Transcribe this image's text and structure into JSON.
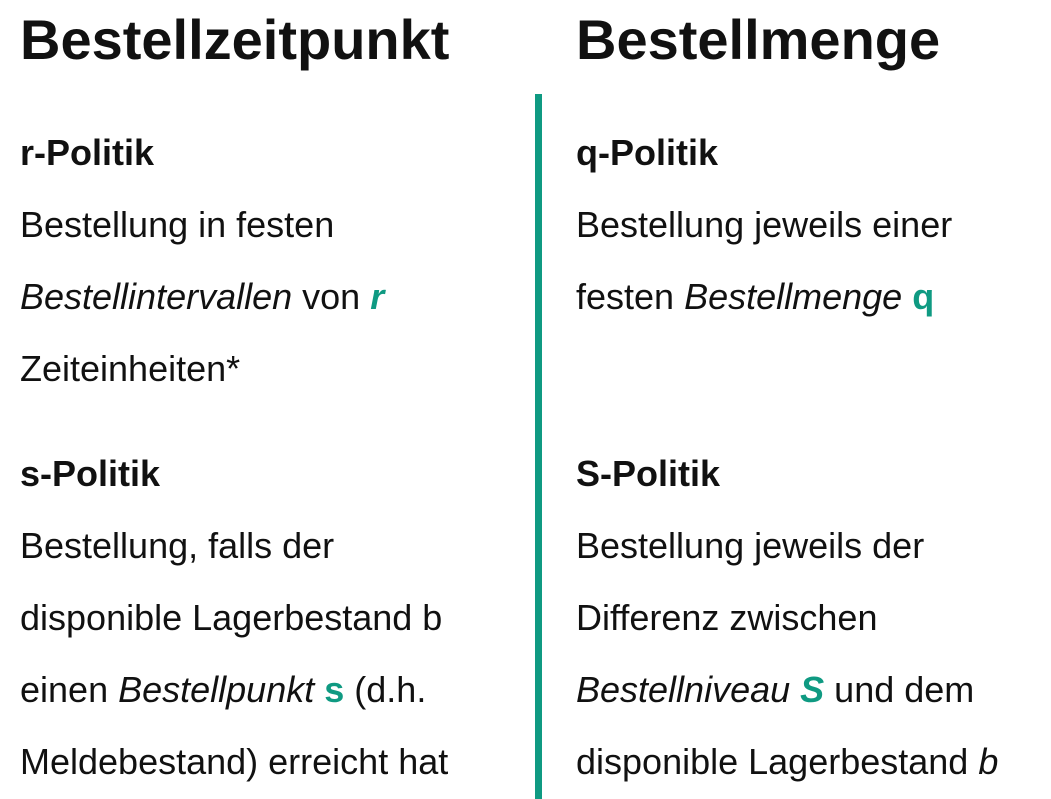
{
  "headings": {
    "left": "Bestellzeitpunkt",
    "right": "Bestellmenge"
  },
  "accent_color": "#0f9a82",
  "r_politik": {
    "title": "r-Politik",
    "line1": "Bestellung in festen",
    "line2_italic": "Bestellintervallen",
    "line2_text": " von ",
    "line2_var": "r",
    "line3": "Zeiteinheiten*"
  },
  "q_politik": {
    "title": "q-Politik",
    "line1": "Bestellung jeweils einer",
    "line2_text": "festen ",
    "line2_italic": "Bestellmenge",
    "line2_var": "q"
  },
  "s_politik": {
    "title": "s-Politik",
    "line1": "Bestellung, falls der",
    "line2": "disponible Lagerbestand b",
    "line3_text": "einen ",
    "line3_italic": "Bestellpunkt",
    "line3_var": "s",
    "line3_tail": "(d.h.",
    "line4": "Meldebestand) erreicht hat"
  },
  "S_politik": {
    "title": "S-Politik",
    "line1": "Bestellung jeweils der",
    "line2": "Differenz zwischen",
    "line3_italic": "Bestellniveau",
    "line3_var": "S",
    "line3_tail": " und dem",
    "line4_text": "disponible Lagerbestand ",
    "line4_var": "b"
  }
}
